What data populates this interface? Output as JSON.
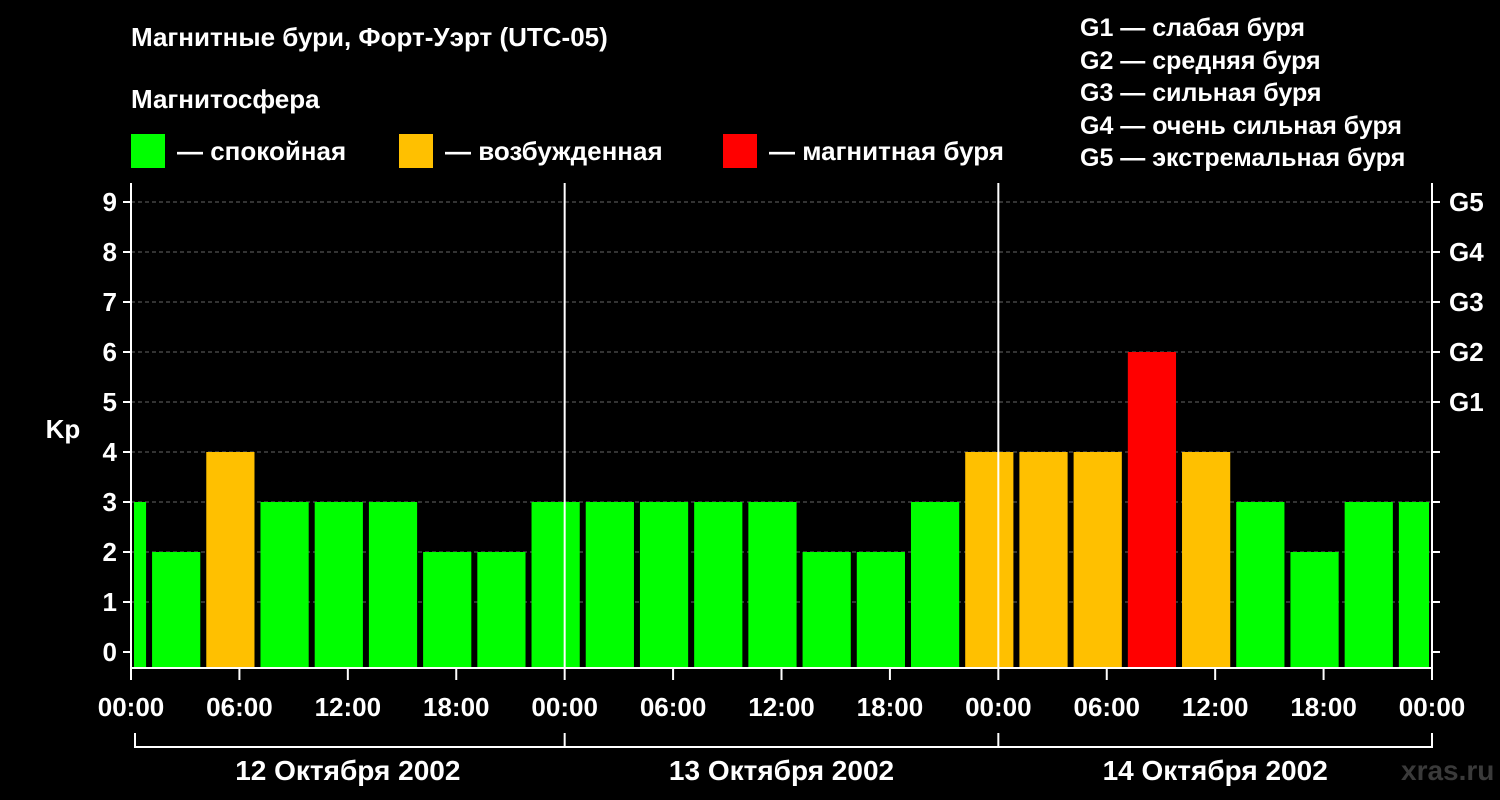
{
  "title": "Магнитные бури, Форт-Уэрт (UTC-05)",
  "magnetosphere_label": "Магнитосфера",
  "legend": [
    {
      "label": "— спокойная",
      "color": "#00ff00"
    },
    {
      "label": "— возбужденная",
      "color": "#ffc000"
    },
    {
      "label": "— магнитная буря",
      "color": "#ff0000"
    }
  ],
  "g_legend": [
    "G1 — слабая буря",
    "G2 — средняя буря",
    "G3 — сильная буря",
    "G4 — очень сильная буря",
    "G5 — экстремальная буря"
  ],
  "watermark": "xras.ru",
  "chart_data": {
    "type": "bar",
    "ylabel": "Kp",
    "ylim": [
      0,
      9
    ],
    "y_ticks": [
      0,
      1,
      2,
      3,
      4,
      5,
      6,
      7,
      8,
      9
    ],
    "right_ticks": [
      {
        "value": 5,
        "label": "G1"
      },
      {
        "value": 6,
        "label": "G2"
      },
      {
        "value": 7,
        "label": "G3"
      },
      {
        "value": 8,
        "label": "G4"
      },
      {
        "value": 9,
        "label": "G5"
      }
    ],
    "x_tick_labels": [
      "00:00",
      "06:00",
      "12:00",
      "18:00",
      "00:00",
      "06:00",
      "12:00",
      "18:00",
      "00:00",
      "06:00",
      "12:00",
      "18:00",
      "00:00"
    ],
    "days": [
      "12 Октября 2002",
      "13 Октября 2002",
      "14 Октября 2002"
    ],
    "grid": true,
    "bars": [
      {
        "start_hour": 0,
        "end_hour": 1,
        "value": 3,
        "color": "#00ff00"
      },
      {
        "start_hour": 1,
        "end_hour": 4,
        "value": 2,
        "color": "#00ff00"
      },
      {
        "start_hour": 4,
        "end_hour": 7,
        "value": 4,
        "color": "#ffc000"
      },
      {
        "start_hour": 7,
        "end_hour": 10,
        "value": 3,
        "color": "#00ff00"
      },
      {
        "start_hour": 10,
        "end_hour": 13,
        "value": 3,
        "color": "#00ff00"
      },
      {
        "start_hour": 13,
        "end_hour": 16,
        "value": 3,
        "color": "#00ff00"
      },
      {
        "start_hour": 16,
        "end_hour": 19,
        "value": 2,
        "color": "#00ff00"
      },
      {
        "start_hour": 19,
        "end_hour": 22,
        "value": 2,
        "color": "#00ff00"
      },
      {
        "start_hour": 22,
        "end_hour": 25,
        "value": 3,
        "color": "#00ff00"
      },
      {
        "start_hour": 25,
        "end_hour": 28,
        "value": 3,
        "color": "#00ff00"
      },
      {
        "start_hour": 28,
        "end_hour": 31,
        "value": 3,
        "color": "#00ff00"
      },
      {
        "start_hour": 31,
        "end_hour": 34,
        "value": 3,
        "color": "#00ff00"
      },
      {
        "start_hour": 34,
        "end_hour": 37,
        "value": 3,
        "color": "#00ff00"
      },
      {
        "start_hour": 37,
        "end_hour": 40,
        "value": 2,
        "color": "#00ff00"
      },
      {
        "start_hour": 40,
        "end_hour": 43,
        "value": 2,
        "color": "#00ff00"
      },
      {
        "start_hour": 43,
        "end_hour": 46,
        "value": 3,
        "color": "#00ff00"
      },
      {
        "start_hour": 46,
        "end_hour": 49,
        "value": 4,
        "color": "#ffc000"
      },
      {
        "start_hour": 49,
        "end_hour": 52,
        "value": 4,
        "color": "#ffc000"
      },
      {
        "start_hour": 52,
        "end_hour": 55,
        "value": 4,
        "color": "#ffc000"
      },
      {
        "start_hour": 55,
        "end_hour": 58,
        "value": 6,
        "color": "#ff0000"
      },
      {
        "start_hour": 58,
        "end_hour": 61,
        "value": 4,
        "color": "#ffc000"
      },
      {
        "start_hour": 61,
        "end_hour": 64,
        "value": 3,
        "color": "#00ff00"
      },
      {
        "start_hour": 64,
        "end_hour": 67,
        "value": 2,
        "color": "#00ff00"
      },
      {
        "start_hour": 67,
        "end_hour": 70,
        "value": 3,
        "color": "#00ff00"
      },
      {
        "start_hour": 70,
        "end_hour": 72,
        "value": 3,
        "color": "#00ff00"
      }
    ]
  }
}
